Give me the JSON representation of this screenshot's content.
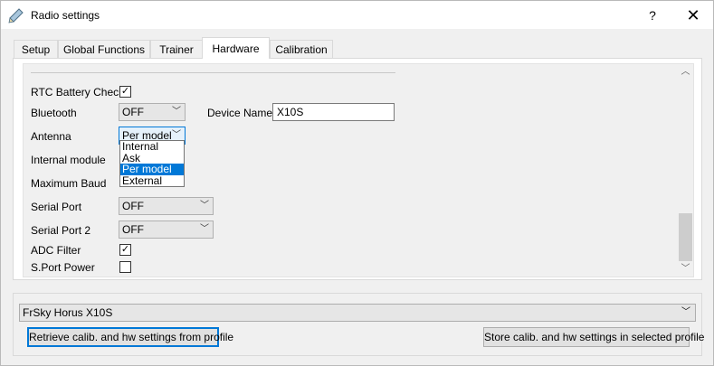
{
  "window": {
    "title": "Radio settings",
    "help_label": "?",
    "close_label": "✕"
  },
  "tabs": [
    {
      "label": "Setup"
    },
    {
      "label": "Global Functions"
    },
    {
      "label": "Trainer"
    },
    {
      "label": "Hardware",
      "active": true
    },
    {
      "label": "Calibration"
    }
  ],
  "hardware": {
    "rtc_battery_check": {
      "label": "RTC Battery Check",
      "checked": true
    },
    "bluetooth": {
      "label": "Bluetooth",
      "value": "OFF"
    },
    "device_name": {
      "label": "Device Name:",
      "value": "X10S"
    },
    "antenna": {
      "label": "Antenna",
      "value": "Per model"
    },
    "internal_module": {
      "label": "Internal module"
    },
    "maximum_baud": {
      "label": "Maximum Baud"
    },
    "serial_port": {
      "label": "Serial Port",
      "value": "OFF"
    },
    "serial_port_2": {
      "label": "Serial Port 2",
      "value": "OFF"
    },
    "adc_filter": {
      "label": "ADC Filter",
      "checked": true
    },
    "sport_power": {
      "label": "S.Port Power",
      "checked": false
    }
  },
  "antenna_dropdown": {
    "options": [
      "Internal",
      "Ask",
      "Per model",
      "External"
    ],
    "selected": "Per model"
  },
  "profile": {
    "selected": "FrSky Horus X10S",
    "retrieve_label": "Retrieve calib. and hw settings from profile",
    "store_label": "Store calib. and hw settings in selected profile"
  },
  "icons": {
    "app": "radio-settings-icon",
    "check": "✓",
    "chevron_down": "﹀",
    "scroll_up": "︿",
    "scroll_down": "﹀"
  },
  "colors": {
    "accent": "#0078d7",
    "panel_bg": "#f0f0f0",
    "tab_panel_bg": "#ffffff"
  }
}
